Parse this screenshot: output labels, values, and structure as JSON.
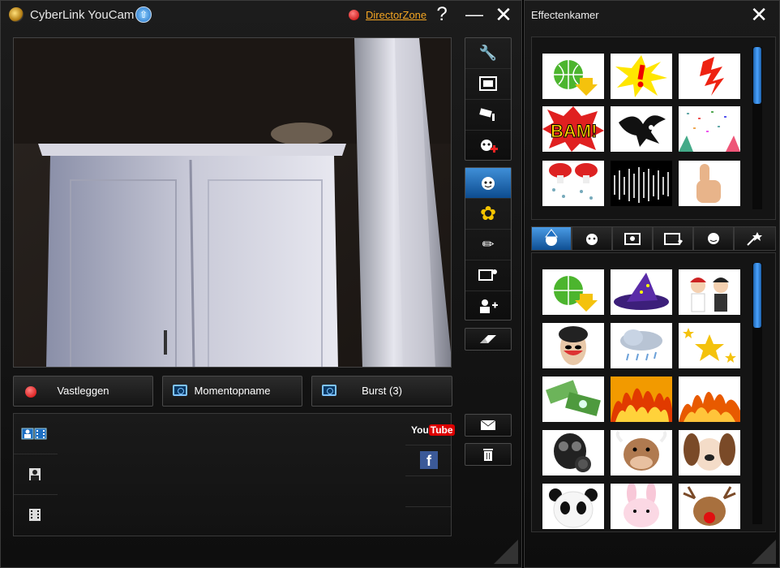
{
  "app": {
    "title": "CyberLink YouCam",
    "update_icon": "arrow-up-icon",
    "director_zone_link": "DirectorZone",
    "help_label": "?",
    "minimize_label": "—",
    "close_label": "✕"
  },
  "capture_buttons": {
    "record_label": "Vastleggen",
    "snapshot_label": "Momentopname",
    "burst_label": "Burst (3)"
  },
  "library": {
    "tabs": [
      "all-media-icon",
      "photos-icon",
      "videos-icon"
    ],
    "share": {
      "youtube_label": "YouTube",
      "facebook_label": "f"
    }
  },
  "toolbar_top": [
    "tools-icon",
    "fullscreen-icon",
    "surveillance-camera-icon",
    "add-effect-icon"
  ],
  "toolbar_effects": [
    "effects-icon",
    "gadgets-icon",
    "draw-icon",
    "scene-icon",
    "avatar-icon"
  ],
  "effects_panel": {
    "title": "Effectenkamer",
    "close_label": "✕",
    "recent_effects": [
      "download-globe",
      "exclamation-burst",
      "red-lightning",
      "bam-comic",
      "black-bird",
      "confetti",
      "red-mushrooms",
      "equalizer-bars",
      "thumbs-up"
    ],
    "tabs": [
      "character-icon",
      "emotion-icon",
      "frame-icon",
      "filter-icon",
      "face-icon",
      "magic-icon"
    ],
    "effects": [
      "download-globe",
      "witch-hat",
      "angel-devil",
      "opera-mask",
      "rain-cloud",
      "stars",
      "money-bills",
      "flames",
      "fire",
      "gas-mask",
      "cow-face",
      "dog-ears",
      "panda-face",
      "bunny-face",
      "reindeer-face"
    ]
  },
  "colors": {
    "accent": "#1e6fc2",
    "record": "#d00000",
    "link": "#f5a623"
  }
}
